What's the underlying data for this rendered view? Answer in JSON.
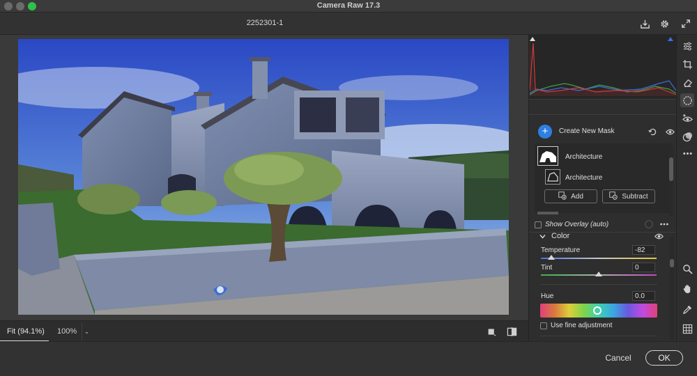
{
  "window": {
    "app_title": "Camera Raw 17.3",
    "file_name": "2252301-1"
  },
  "masking": {
    "create_label": "Create New Mask",
    "masks": [
      {
        "label": "Architecture"
      },
      {
        "label": "Architecture"
      }
    ],
    "add_label": "Add",
    "subtract_label": "Subtract",
    "overlay_label": "Show Overlay (auto)"
  },
  "color_panel": {
    "title": "Color",
    "temperature": {
      "label": "Temperature",
      "value": "-82",
      "level": -0.82
    },
    "tint": {
      "label": "Tint",
      "value": "0",
      "level": 0
    },
    "hue": {
      "label": "Hue",
      "value": "0.0",
      "level": 0
    },
    "fine_adjustment_label": "Use fine adjustment"
  },
  "zoom": {
    "fit_label": "Fit (94.1%)",
    "percent_label": "100%"
  },
  "footer": {
    "cancel_label": "Cancel",
    "ok_label": "OK"
  },
  "colors": {
    "accent": "#2f7fe3",
    "background": "#323232",
    "panel": "#2e2e2e"
  },
  "icons": {
    "header": [
      "save-icon",
      "settings-gear-icon",
      "fullscreen-icon"
    ],
    "tools": [
      "edit-sliders-icon",
      "crop-icon",
      "eraser-icon",
      "masking-icon",
      "red-eye-icon",
      "presets-icon",
      "more-icon",
      "zoom-icon",
      "hand-icon",
      "eyedropper-icon",
      "grid-icon"
    ]
  }
}
